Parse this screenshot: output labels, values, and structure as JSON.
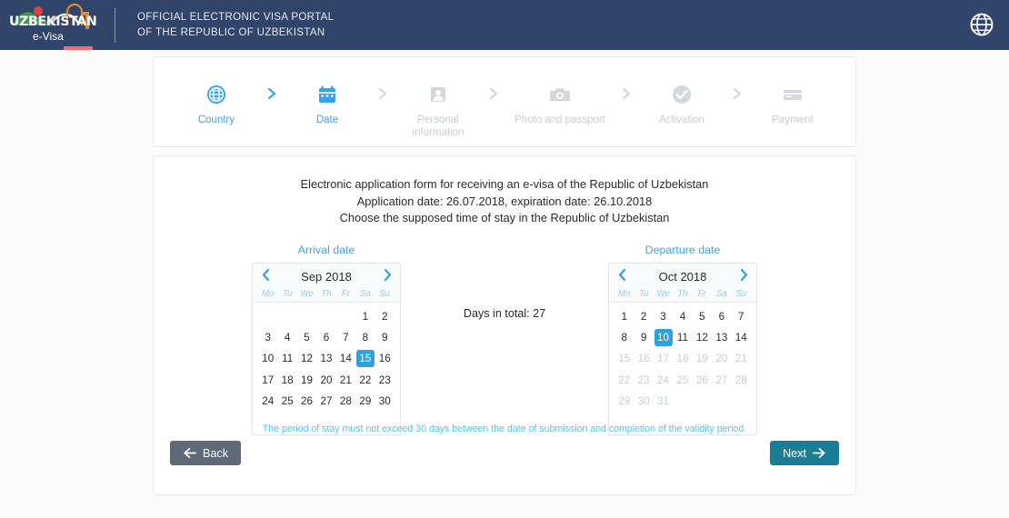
{
  "header": {
    "logo_word": "UZBEKISTAN",
    "logo_sub": "e-Visa",
    "title_line1": "OFFICIAL ELECTRONIC VISA PORTAL",
    "title_line2": "OF THE REPUBLIC OF UZBEKISTAN",
    "lang_icon": "globe-icon",
    "bg_color": "#31456a",
    "accent_color": "#f06e6e"
  },
  "steps": [
    {
      "label": "Country",
      "icon": "globe-icon",
      "state": "active"
    },
    {
      "label": "Date",
      "icon": "calendar-icon",
      "state": "active"
    },
    {
      "label": "Personal\ninformation",
      "icon": "person-icon",
      "state": "inactive"
    },
    {
      "label": "Photo and passport",
      "icon": "camera-icon",
      "state": "inactive"
    },
    {
      "label": "Activation",
      "icon": "check-circle-icon",
      "state": "inactive"
    },
    {
      "label": "Payment",
      "icon": "credit-card-icon",
      "state": "inactive"
    }
  ],
  "step_colors": {
    "active": "#38a4e8",
    "inactive": "#c9ccd1"
  },
  "main": {
    "heading_line1": "Electronic application form for receiving an e-visa of the Republic of Uzbekistan",
    "heading_line2": "Application date: 26.07.2018, expiration date: 26.10.2018",
    "heading_line3": "Choose the supposed time of stay in the Republic of Uzbekistan",
    "application_date": "26.07.2018",
    "expiration_date": "26.10.2018",
    "days_total_label": "Days in total: 27",
    "days_total": 27,
    "note": "The period of stay must not exceed 30 days between the date of submission and completion of the validity period.",
    "note_color": "#50c3e8"
  },
  "calendars": {
    "arrival": {
      "title": "Arrival date",
      "month_label": "Sep 2018",
      "month": 9,
      "year": 2018,
      "selected_day": 15,
      "dow": [
        "Mo",
        "Tu",
        "We",
        "Th",
        "Fr",
        "Sa",
        "Su"
      ],
      "weeks": [
        [
          {
            "d": "",
            "t": "empty"
          },
          {
            "d": "",
            "t": "empty"
          },
          {
            "d": "",
            "t": "empty"
          },
          {
            "d": "",
            "t": "empty"
          },
          {
            "d": "",
            "t": "empty"
          },
          {
            "d": "1",
            "t": "day"
          },
          {
            "d": "2",
            "t": "day"
          }
        ],
        [
          {
            "d": "3",
            "t": "day"
          },
          {
            "d": "4",
            "t": "day"
          },
          {
            "d": "5",
            "t": "day"
          },
          {
            "d": "6",
            "t": "day"
          },
          {
            "d": "7",
            "t": "day"
          },
          {
            "d": "8",
            "t": "day"
          },
          {
            "d": "9",
            "t": "day"
          }
        ],
        [
          {
            "d": "10",
            "t": "day"
          },
          {
            "d": "11",
            "t": "day"
          },
          {
            "d": "12",
            "t": "day"
          },
          {
            "d": "13",
            "t": "day"
          },
          {
            "d": "14",
            "t": "day"
          },
          {
            "d": "15",
            "t": "sel"
          },
          {
            "d": "16",
            "t": "day"
          }
        ],
        [
          {
            "d": "17",
            "t": "day"
          },
          {
            "d": "18",
            "t": "day"
          },
          {
            "d": "19",
            "t": "day"
          },
          {
            "d": "20",
            "t": "day"
          },
          {
            "d": "21",
            "t": "day"
          },
          {
            "d": "22",
            "t": "day"
          },
          {
            "d": "23",
            "t": "day"
          }
        ],
        [
          {
            "d": "24",
            "t": "day"
          },
          {
            "d": "25",
            "t": "day"
          },
          {
            "d": "26",
            "t": "day"
          },
          {
            "d": "27",
            "t": "day"
          },
          {
            "d": "28",
            "t": "day"
          },
          {
            "d": "29",
            "t": "day"
          },
          {
            "d": "30",
            "t": "day"
          }
        ],
        [
          {
            "d": "",
            "t": "empty"
          },
          {
            "d": "",
            "t": "empty"
          },
          {
            "d": "",
            "t": "empty"
          },
          {
            "d": "",
            "t": "empty"
          },
          {
            "d": "",
            "t": "empty"
          },
          {
            "d": "",
            "t": "empty"
          },
          {
            "d": "",
            "t": "empty"
          }
        ]
      ]
    },
    "departure": {
      "title": "Departure date",
      "month_label": "Oct 2018",
      "month": 10,
      "year": 2018,
      "selected_day": 10,
      "dow": [
        "Mo",
        "Tu",
        "We",
        "Th",
        "Fr",
        "Sa",
        "Su"
      ],
      "weeks": [
        [
          {
            "d": "1",
            "t": "day"
          },
          {
            "d": "2",
            "t": "day"
          },
          {
            "d": "3",
            "t": "day"
          },
          {
            "d": "4",
            "t": "day"
          },
          {
            "d": "5",
            "t": "day"
          },
          {
            "d": "6",
            "t": "day"
          },
          {
            "d": "7",
            "t": "day"
          }
        ],
        [
          {
            "d": "8",
            "t": "day"
          },
          {
            "d": "9",
            "t": "day"
          },
          {
            "d": "10",
            "t": "sel"
          },
          {
            "d": "11",
            "t": "day"
          },
          {
            "d": "12",
            "t": "day"
          },
          {
            "d": "13",
            "t": "day"
          },
          {
            "d": "14",
            "t": "day"
          }
        ],
        [
          {
            "d": "15",
            "t": "dis"
          },
          {
            "d": "16",
            "t": "dis"
          },
          {
            "d": "17",
            "t": "dis"
          },
          {
            "d": "18",
            "t": "dis"
          },
          {
            "d": "19",
            "t": "dis"
          },
          {
            "d": "20",
            "t": "dis"
          },
          {
            "d": "21",
            "t": "dis"
          }
        ],
        [
          {
            "d": "22",
            "t": "dis"
          },
          {
            "d": "23",
            "t": "dis"
          },
          {
            "d": "24",
            "t": "dis"
          },
          {
            "d": "25",
            "t": "dis"
          },
          {
            "d": "26",
            "t": "dis"
          },
          {
            "d": "27",
            "t": "dis"
          },
          {
            "d": "28",
            "t": "dis"
          }
        ],
        [
          {
            "d": "29",
            "t": "dis"
          },
          {
            "d": "30",
            "t": "dis"
          },
          {
            "d": "31",
            "t": "dis"
          },
          {
            "d": "",
            "t": "empty"
          },
          {
            "d": "",
            "t": "empty"
          },
          {
            "d": "",
            "t": "empty"
          },
          {
            "d": "",
            "t": "empty"
          }
        ],
        [
          {
            "d": "",
            "t": "empty"
          },
          {
            "d": "",
            "t": "empty"
          },
          {
            "d": "",
            "t": "empty"
          },
          {
            "d": "",
            "t": "empty"
          },
          {
            "d": "",
            "t": "empty"
          },
          {
            "d": "",
            "t": "empty"
          },
          {
            "d": "",
            "t": "empty"
          }
        ]
      ]
    },
    "prev_icon": "chevron-left-icon",
    "next_icon": "chevron-right-icon",
    "selected_color": "#2ea2de",
    "title_color": "#3fa3e8"
  },
  "footer": {
    "back_label": "Back",
    "back_icon": "arrow-left-icon",
    "back_color": "#5f6a78",
    "next_label": "Next",
    "next_icon": "arrow-right-icon",
    "next_color": "#1a7f96"
  }
}
